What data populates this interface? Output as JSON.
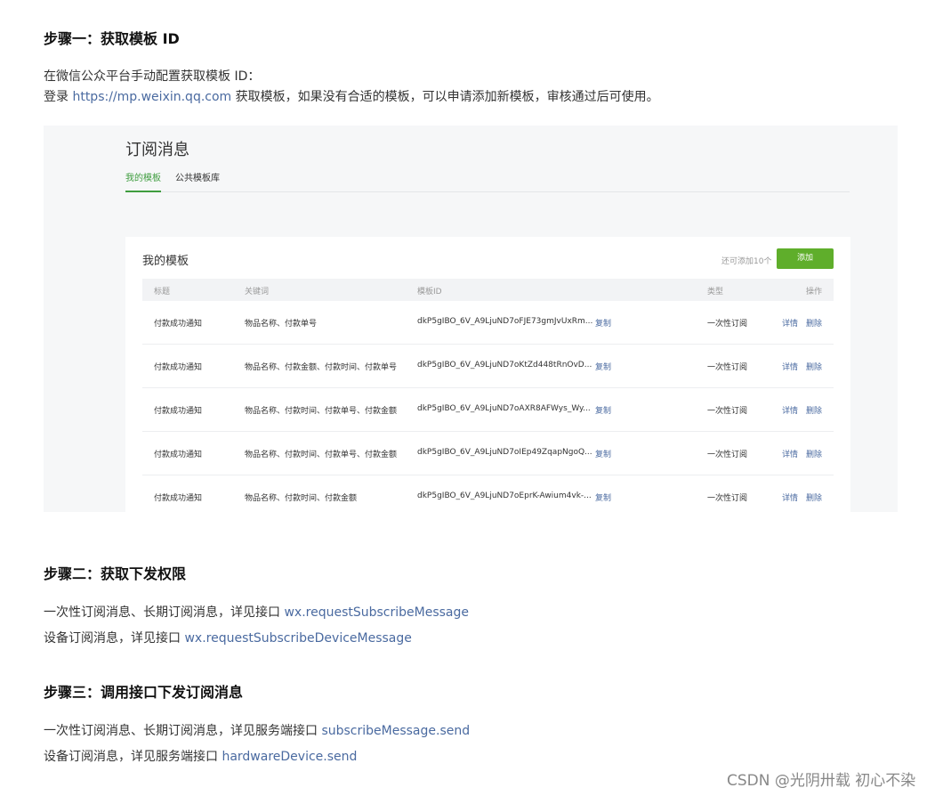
{
  "step1": {
    "heading": "步骤一：获取模板 ID",
    "line1": "在微信公众平台手动配置获取模板 ID：",
    "line2_prefix": "登录 ",
    "line2_link": "https://mp.weixin.qq.com",
    "line2_suffix": " 获取模板，如果没有合适的模板，可以申请添加新模板，审核通过后可使用。"
  },
  "screenshot": {
    "title": "订阅消息",
    "tabs": [
      "我的模板",
      "公共模板库"
    ],
    "card_title": "我的模板",
    "hint": "还可添加10个",
    "add_button": "添加",
    "columns": [
      "标题",
      "关键词",
      "模板ID",
      "类型",
      "操作"
    ],
    "rows": [
      {
        "title": "付款成功通知",
        "keywords": "物品名称、付款单号",
        "id": "dkP5gIBO_6V_A9LjuND7oFJE73gmJvUxRm...",
        "copy": "复制",
        "type": "一次性订阅",
        "detail": "详情",
        "delete": "删除"
      },
      {
        "title": "付款成功通知",
        "keywords": "物品名称、付款金额、付款时间、付款单号",
        "id": "dkP5gIBO_6V_A9LjuND7oKtZd448tRnOvD...",
        "copy": "复制",
        "type": "一次性订阅",
        "detail": "详情",
        "delete": "删除"
      },
      {
        "title": "付款成功通知",
        "keywords": "物品名称、付款时间、付款单号、付款金额",
        "id": "dkP5gIBO_6V_A9LjuND7oAXR8AFWys_Wy...",
        "copy": "复制",
        "type": "一次性订阅",
        "detail": "详情",
        "delete": "删除"
      },
      {
        "title": "付款成功通知",
        "keywords": "物品名称、付款时间、付款单号、付款金额",
        "id": "dkP5gIBO_6V_A9LjuND7oIEp49ZqapNgoQ...",
        "copy": "复制",
        "type": "一次性订阅",
        "detail": "详情",
        "delete": "删除"
      },
      {
        "title": "付款成功通知",
        "keywords": "物品名称、付款时间、付款金额",
        "id": "dkP5gIBO_6V_A9LjuND7oEprK-Awium4vk-...",
        "copy": "复制",
        "type": "一次性订阅",
        "detail": "详情",
        "delete": "删除"
      }
    ]
  },
  "step2": {
    "heading": "步骤二：获取下发权限",
    "line1_text": "一次性订阅消息、长期订阅消息，详见接口 ",
    "line1_link": "wx.requestSubscribeMessage",
    "line2_text": "设备订阅消息，详见接口 ",
    "line2_link": "wx.requestSubscribeDeviceMessage"
  },
  "step3": {
    "heading": "步骤三：调用接口下发订阅消息",
    "line1_text": "一次性订阅消息、长期订阅消息，详见服务端接口 ",
    "line1_link": "subscribeMessage.send",
    "line2_text": "设备订阅消息，详见服务端接口 ",
    "line2_link": "hardwareDevice.send"
  },
  "watermark": "CSDN @光阴卅载 初心不染"
}
